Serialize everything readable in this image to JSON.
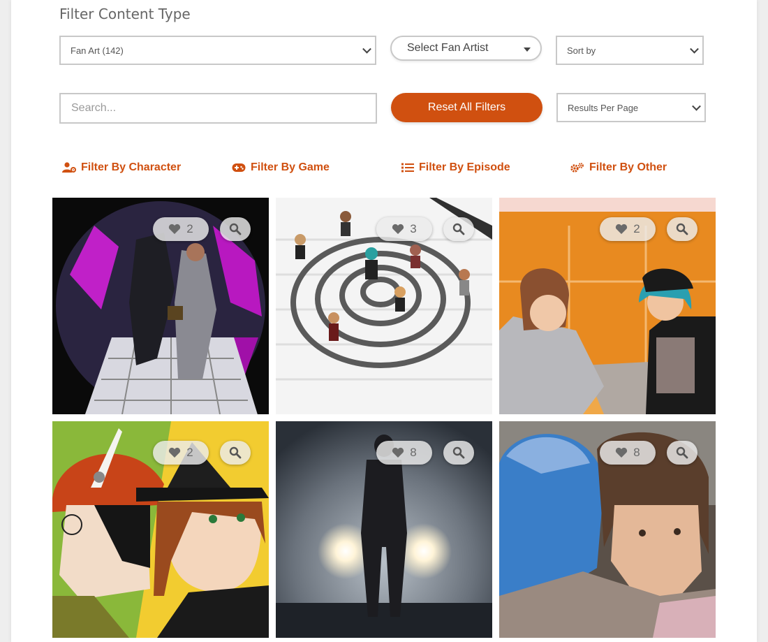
{
  "filters": {
    "heading": "Filter Content Type",
    "content_type": "Fan Art (142)",
    "fan_artist": "Select Fan Artist",
    "sort_by": "Sort by",
    "search_placeholder": "Search...",
    "reset_label": "Reset All Filters",
    "results_per_page": "Results Per Page"
  },
  "filter_links": [
    {
      "label": "Filter By Character",
      "icon": "user-gear-icon"
    },
    {
      "label": "Filter By Game",
      "icon": "gamepad-icon"
    },
    {
      "label": "Filter By Episode",
      "icon": "list-icon"
    },
    {
      "label": "Filter By Other",
      "icon": "gears-icon"
    }
  ],
  "gallery": [
    {
      "likes": "2"
    },
    {
      "likes": "3"
    },
    {
      "likes": "2"
    },
    {
      "likes": "2"
    },
    {
      "likes": "8"
    },
    {
      "likes": "8"
    }
  ],
  "colors": {
    "accent": "#d05010",
    "panel": "#ffffff",
    "border": "#c8c8c8"
  }
}
